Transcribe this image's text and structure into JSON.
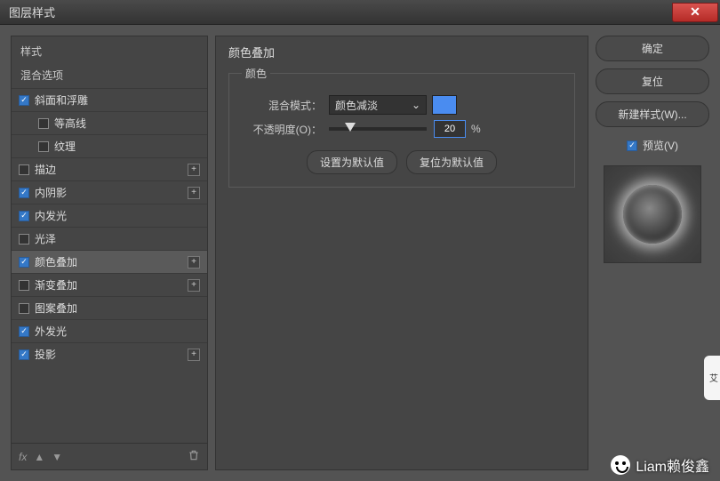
{
  "window": {
    "title": "图层样式"
  },
  "left": {
    "head": "样式",
    "blending": "混合选项",
    "items": [
      {
        "label": "斜面和浮雕",
        "checked": true,
        "hasPlus": false,
        "indent": false
      },
      {
        "label": "等高线",
        "checked": false,
        "hasPlus": false,
        "indent": true
      },
      {
        "label": "纹理",
        "checked": false,
        "hasPlus": false,
        "indent": true
      },
      {
        "label": "描边",
        "checked": false,
        "hasPlus": true,
        "indent": false
      },
      {
        "label": "内阴影",
        "checked": true,
        "hasPlus": true,
        "indent": false
      },
      {
        "label": "内发光",
        "checked": true,
        "hasPlus": false,
        "indent": false
      },
      {
        "label": "光泽",
        "checked": false,
        "hasPlus": false,
        "indent": false
      },
      {
        "label": "颜色叠加",
        "checked": true,
        "hasPlus": true,
        "indent": false,
        "selected": true
      },
      {
        "label": "渐变叠加",
        "checked": false,
        "hasPlus": true,
        "indent": false
      },
      {
        "label": "图案叠加",
        "checked": false,
        "hasPlus": false,
        "indent": false
      },
      {
        "label": "外发光",
        "checked": true,
        "hasPlus": false,
        "indent": false
      },
      {
        "label": "投影",
        "checked": true,
        "hasPlus": true,
        "indent": false
      }
    ],
    "footer_fx": "fx"
  },
  "center": {
    "section": "颜色叠加",
    "group": "颜色",
    "blend_label": "混合模式：",
    "blend_value": "颜色减淡",
    "opacity_label": "不透明度(O)：",
    "opacity_value": "20",
    "opacity_unit": "%",
    "btn_default": "设置为默认值",
    "btn_reset": "复位为默认值",
    "color_swatch": "#4a8cf0"
  },
  "right": {
    "ok": "确定",
    "cancel": "复位",
    "newstyle": "新建样式(W)...",
    "preview": "预览(V)"
  },
  "watermark": "Liam赖俊鑫"
}
